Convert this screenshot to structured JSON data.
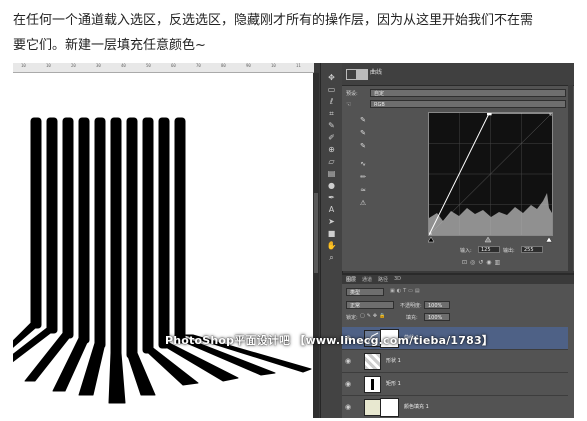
{
  "caption": {
    "line1": "在任何一个通道载入选区，反选选区，隐藏刚才所有的操作层，因为从这里开始我们不在需",
    "line2": "要它们。新建一层填充任意颜色~"
  },
  "colors": {
    "panel_bg": "#535353",
    "panel_dark": "#404040",
    "canvas_bg": "#ffffff",
    "selected_layer": "#4e6186",
    "graph_bg": "#111111"
  },
  "ruler": {
    "ticks": [
      "10",
      "10",
      "20",
      "30",
      "40",
      "50",
      "60",
      "70",
      "80",
      "90",
      "10",
      "11"
    ]
  },
  "tools": [
    "move-icon",
    "marquee-icon",
    "lasso-icon",
    "crop-icon",
    "eyedropper-icon",
    "brush-icon",
    "clone-icon",
    "eraser-icon",
    "gradient-icon",
    "dodge-icon",
    "pen-icon",
    "text-icon",
    "path-select-icon",
    "shape-icon",
    "hand-icon",
    "zoom-icon"
  ],
  "properties": {
    "title": "曲线",
    "preset_label": "预设:",
    "preset_value": "自定",
    "channel_value": "RGB",
    "input_label": "输入:",
    "input_value": "125",
    "output_label": "输出:",
    "output_value": "255",
    "curve_points": [
      [
        0,
        0
      ],
      [
        125,
        255
      ],
      [
        255,
        255
      ]
    ]
  },
  "layers": {
    "tabs": [
      "图层",
      "通道",
      "路径",
      "3D"
    ],
    "filter_label": "类型",
    "blend_mode": "正常",
    "opacity_label": "不透明度:",
    "opacity_value": "100%",
    "lock_label": "锁定:",
    "fill_label": "填充:",
    "fill_value": "100%",
    "items": [
      {
        "name": "曲线 1",
        "selected": true,
        "kind": "adjustment"
      },
      {
        "name": "形状 1",
        "selected": false,
        "kind": "shape"
      },
      {
        "name": "矩形 1",
        "selected": false,
        "kind": "shape"
      },
      {
        "name": "颜色填充 1",
        "selected": false,
        "kind": "fill"
      }
    ]
  },
  "watermark": "PhotoShop平面设计吧 【www.linecg.com/tieba/1783】"
}
